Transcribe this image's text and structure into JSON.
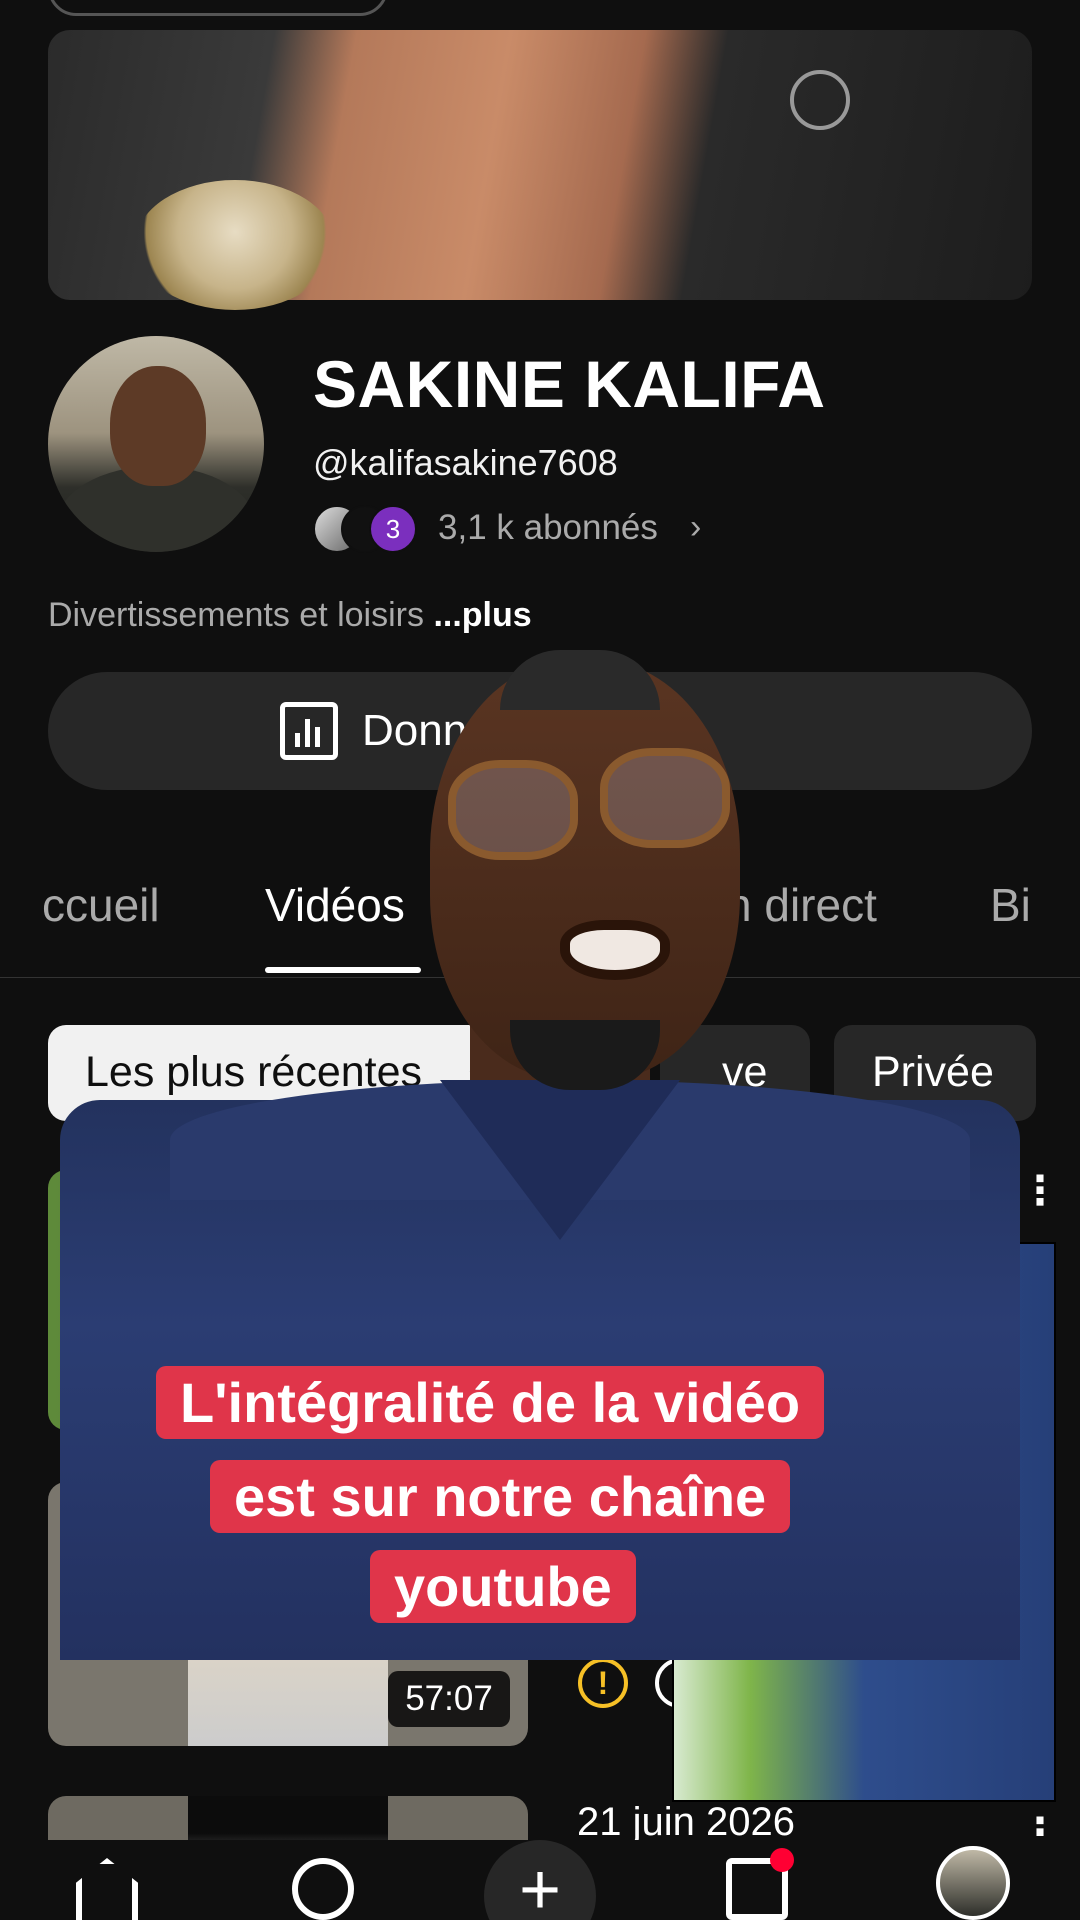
{
  "channel": {
    "name": "SAKINE KALIFA",
    "handle": "@kalifasakine7608",
    "subscriber_badge": "3",
    "subscribers": "3,1 k abonnés",
    "description": "Divertissements et loisirs",
    "description_more": "...plus"
  },
  "analytics_button": {
    "label": "Données analytiques",
    "visible_label": "Donn"
  },
  "tabs": [
    {
      "label": "Accueil",
      "visible": "ccueil"
    },
    {
      "label": "Vidéos",
      "visible": "Vidéos",
      "selected": true
    },
    {
      "label": "En direct",
      "visible": "n direct"
    },
    {
      "label": "Bi",
      "visible": "Bi"
    }
  ],
  "chips": {
    "sort": "Les plus récentes",
    "partial": "ve",
    "private": "Privée"
  },
  "videos": [
    {
      "duration": "",
      "date": ""
    },
    {
      "duration": "57:07"
    },
    {
      "date": "21 juin 2026"
    }
  ],
  "caption": {
    "line1": "L'intégralité de la vidéo",
    "line2": "est sur notre chaîne",
    "line3": "youtube"
  },
  "bottom_nav": {
    "home": "home-icon",
    "shorts": "shorts-icon",
    "create": "+",
    "subscriptions": "subscriptions-icon",
    "you": "profile-avatar"
  },
  "colors": {
    "background": "#0f0f0f",
    "chip_active": "#f1f1f1",
    "caption_bg": "#e0354a",
    "warning": "#f6c026",
    "notification_dot": "#ff0033"
  }
}
